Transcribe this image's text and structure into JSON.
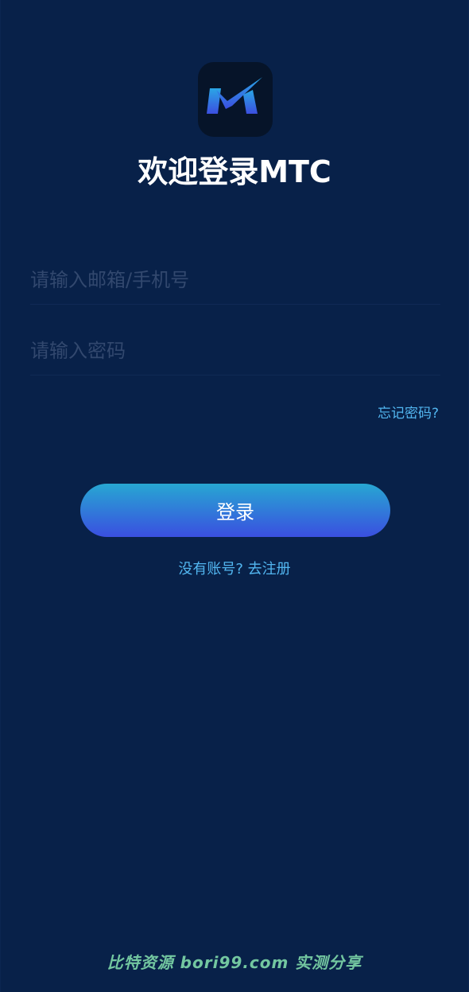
{
  "app": {
    "title": "欢迎登录MTC"
  },
  "logo": {
    "icon": "mtc-logo-icon",
    "accent_top": "#2aa6e6",
    "accent_bottom": "#3b4fe0",
    "background": "#061429"
  },
  "form": {
    "email_placeholder": "请输入邮箱/手机号",
    "email_value": "",
    "password_placeholder": "请输入密码",
    "password_value": "",
    "forgot_label": "忘记密码?",
    "login_label": "登录",
    "register_label": "没有账号? 去注册"
  },
  "watermark": {
    "text": "比特资源 bori99.com 实测分享"
  },
  "colors": {
    "background": "#082149",
    "link": "#52b6f0",
    "button_top": "#27a7d2",
    "button_bottom": "#3a4fe0",
    "watermark": "#73c7a0"
  }
}
